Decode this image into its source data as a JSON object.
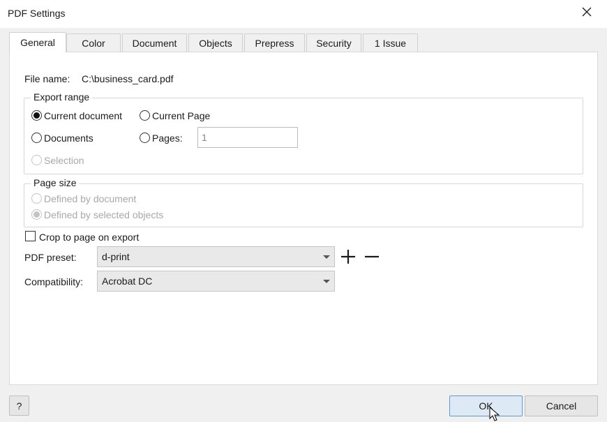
{
  "window": {
    "title": "PDF Settings"
  },
  "tabs": [
    {
      "label": "General"
    },
    {
      "label": "Color"
    },
    {
      "label": "Document"
    },
    {
      "label": "Objects"
    },
    {
      "label": "Prepress"
    },
    {
      "label": "Security"
    },
    {
      "label": "1 Issue"
    }
  ],
  "general": {
    "file_name_label": "File name:",
    "file_name_value": "C:\\business_card.pdf",
    "export_range": {
      "legend": "Export range",
      "current_document": "Current document",
      "current_page": "Current Page",
      "documents": "Documents",
      "pages": "Pages:",
      "pages_value": "1",
      "selection": "Selection",
      "selected": "current_document"
    },
    "page_size": {
      "legend": "Page size",
      "defined_by_document": "Defined by document",
      "defined_by_selected_objects": "Defined by selected objects",
      "selected": "defined_by_selected_objects"
    },
    "crop_to_page": {
      "label": "Crop to page on export",
      "checked": false
    },
    "pdf_preset": {
      "label": "PDF preset:",
      "value": "d-print"
    },
    "compatibility": {
      "label": "Compatibility:",
      "value": "Acrobat DC"
    }
  },
  "footer": {
    "help_label": "?",
    "ok_label": "OK",
    "cancel_label": "Cancel"
  }
}
